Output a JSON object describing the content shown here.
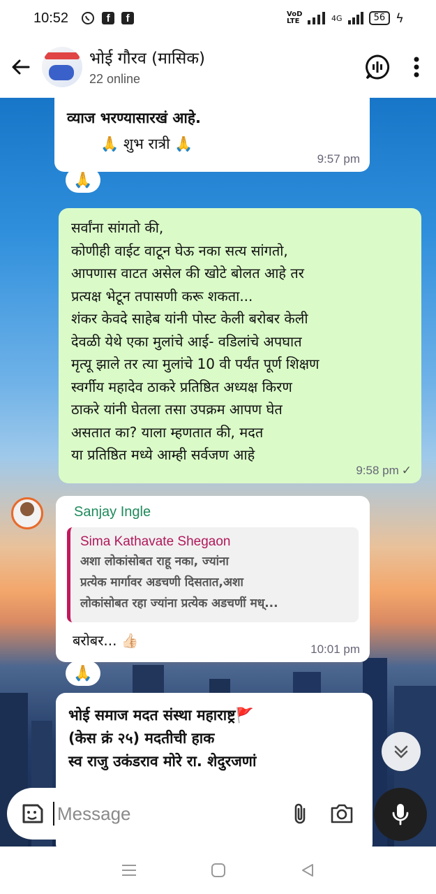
{
  "status_bar": {
    "time": "10:52",
    "network": "VoD LTE",
    "signal_label": "4G",
    "battery": "56"
  },
  "header": {
    "title": "भोई गौरव (मासिक)",
    "subtitle": "22 online"
  },
  "messages": [
    {
      "type": "incoming",
      "partial_text": "व्याज भरण्यासारखं  आहे.",
      "signature": "🙏 शुभ रात्री 🙏",
      "time": "9:57 pm",
      "reaction": "🙏"
    },
    {
      "type": "outgoing",
      "lines": [
        "सर्वांना सांगतो की,",
        "कोणीही वाईट वाटून घेऊ नका सत्य सांगतो,",
        "आपणास वाटत असेल की खोटे बोलत आहे तर",
        "प्रत्यक्ष भेटून तपासणी करू शकता...",
        "शंकर केवदे साहेब  यांनी पोस्ट केली बरोबर केली",
        "देवळी येथे एका मुलांचे आई- वडिलांचे अपघात",
        "मृत्यू झाले तर त्या मुलांचे 10 वी पर्यंत पूर्ण शिक्षण",
        "स्वर्गीय महादेव ठाकरे प्रतिष्ठित अध्यक्ष किरण",
        "ठाकरे यांनी घेतला तसा उपक्रम आपण घेत",
        "असतात का? याला म्हणतात की, मदत",
        "या प्रतिष्ठित मध्ये आम्ही सर्वजण आहे"
      ],
      "time": "9:58 pm",
      "status": "✓"
    },
    {
      "type": "incoming",
      "sender": "Sanjay Ingle",
      "quoted_sender": "Sima Kathavate Shegaon",
      "quoted_lines": [
        "अशा लोकांसोबत राहू नका, ज्यांना",
        "प्रत्येक मार्गावर अडचणी दिसतात,अशा",
        "लोकांसोबत रहा ज्यांना प्रत्येक अडचणीं मध्..."
      ],
      "text": "बरोबर... 👍🏻",
      "time": "10:01 pm",
      "reaction": "🙏"
    },
    {
      "type": "incoming",
      "lines": [
        "भोई समाज मदत संस्था महाराष्ट्र🚩",
        " (केस क्रं २५) मदतीची हाक",
        "स्व राजु उकंडराव मोरे रा. शेदुरजणां"
      ]
    }
  ],
  "composer": {
    "placeholder": "Message"
  },
  "colors": {
    "outgoing_bubble": "#dafbc8",
    "incoming_bubble": "#ffffff",
    "sender_name": "#1e8a5c",
    "quote_bar": "#c2185b"
  }
}
